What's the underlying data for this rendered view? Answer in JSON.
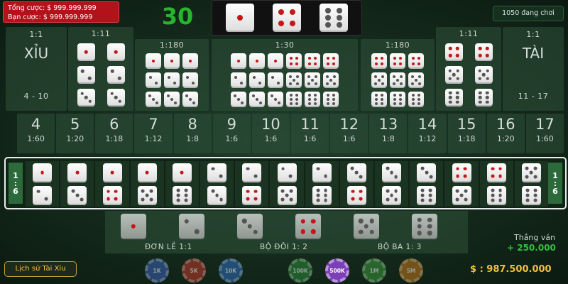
{
  "header": {
    "bet_total": "Tổng cược: $ 999.999.999",
    "bet_own": "Bạn cược: $ 999.999.999",
    "timer": "30",
    "result_dice": [
      1,
      4,
      6
    ],
    "players": "1050 đang chơi"
  },
  "xiu": {
    "ratio": "1:1",
    "label": "XỈU",
    "range": "4 - 10"
  },
  "tai": {
    "ratio": "1:1",
    "label": "TÀI",
    "range": "11 - 17"
  },
  "pairs_left": {
    "ratio": "1:11",
    "faces": [
      1,
      2,
      3
    ]
  },
  "pairs_right": {
    "ratio": "1:11",
    "faces": [
      4,
      5,
      6
    ]
  },
  "triples_left": {
    "ratio": "1:180",
    "faces": [
      1,
      2,
      3
    ]
  },
  "any_triple": {
    "ratio": "1:30"
  },
  "triples_right": {
    "ratio": "1:180",
    "faces": [
      4,
      5,
      6
    ]
  },
  "totals": [
    {
      "n": "4",
      "r": "1:60"
    },
    {
      "n": "5",
      "r": "1:20"
    },
    {
      "n": "6",
      "r": "1:18"
    },
    {
      "n": "7",
      "r": "1:12"
    },
    {
      "n": "8",
      "r": "1:8"
    },
    {
      "n": "9",
      "r": "1:6"
    },
    {
      "n": "10",
      "r": "1:6"
    },
    {
      "n": "11",
      "r": "1:6"
    },
    {
      "n": "12",
      "r": "1:6"
    },
    {
      "n": "13",
      "r": "1:8"
    },
    {
      "n": "14",
      "r": "1:12"
    },
    {
      "n": "15",
      "r": "1:18"
    },
    {
      "n": "16",
      "r": "1:20"
    },
    {
      "n": "17",
      "r": "1:60"
    }
  ],
  "combo_side_ratio": "1 : 6",
  "combos": [
    [
      1,
      2
    ],
    [
      1,
      3
    ],
    [
      1,
      4
    ],
    [
      1,
      5
    ],
    [
      1,
      6
    ],
    [
      2,
      3
    ],
    [
      2,
      4
    ],
    [
      2,
      5
    ],
    [
      2,
      6
    ],
    [
      3,
      4
    ],
    [
      3,
      5
    ],
    [
      3,
      6
    ],
    [
      4,
      5
    ],
    [
      4,
      6
    ],
    [
      5,
      6
    ]
  ],
  "singles": {
    "faces": [
      1,
      2,
      3,
      4,
      5,
      6
    ],
    "label_single": "ĐƠN LẺ 1:1",
    "label_double": "BỘ ĐÔI 1: 2",
    "label_triple": "BỘ BA 1: 3"
  },
  "win": {
    "label": "Thắng ván",
    "value": "+ 250.000"
  },
  "history_button": "Lịch sử Tài Xỉu",
  "chips": [
    {
      "label": "1K",
      "color": "#3a63b8",
      "active": false
    },
    {
      "label": "5K",
      "color": "#c0392b",
      "active": false
    },
    {
      "label": "10K",
      "color": "#2f6fc1",
      "active": false
    },
    {
      "label": "100K",
      "color": "#2c8a3a",
      "active": false
    },
    {
      "label": "500K",
      "color": "#7b3fb8",
      "active": true
    },
    {
      "label": "1M",
      "color": "#3b9a3b",
      "active": false
    },
    {
      "label": "5M",
      "color": "#c47a1b",
      "active": false
    }
  ],
  "balance": "$ : 987.500.000"
}
